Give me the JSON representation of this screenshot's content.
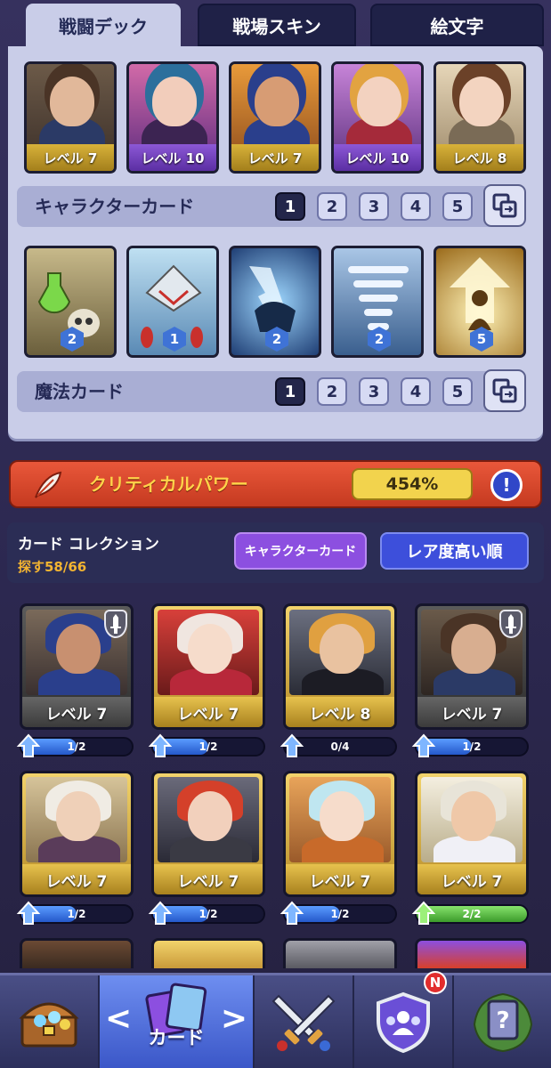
{
  "tabs": [
    {
      "label": "戦闘デック",
      "active": true
    },
    {
      "label": "戦場スキン",
      "active": false
    },
    {
      "label": "絵文字",
      "active": false
    }
  ],
  "deck": {
    "character_cards": [
      {
        "level": "レベル 7",
        "rarity": "gold"
      },
      {
        "level": "レベル 10",
        "rarity": "purple"
      },
      {
        "level": "レベル 7",
        "rarity": "gold"
      },
      {
        "level": "レベル 10",
        "rarity": "purple"
      },
      {
        "level": "レベル 8",
        "rarity": "gold"
      }
    ],
    "character_label": "キャラクターカード",
    "slot_numbers": [
      "1",
      "2",
      "3",
      "4",
      "5"
    ],
    "selected_slot": "1",
    "magic_cards": [
      {
        "badge": "2"
      },
      {
        "badge": "1"
      },
      {
        "badge": "2"
      },
      {
        "badge": "2"
      },
      {
        "badge": "5"
      }
    ],
    "magic_label": "魔法カード"
  },
  "critical": {
    "title": "クリティカルパワー",
    "value": "454%",
    "info_symbol": "!"
  },
  "collection": {
    "title": "カード コレクション",
    "found": "探す58/66",
    "filter_button": "キャラクターカード",
    "sort_button": "レア度高い順",
    "cards": [
      {
        "level": "レベル 7",
        "progress": "1/2",
        "ratio": 0.5,
        "frame": "dark",
        "sword": true
      },
      {
        "level": "レベル 7",
        "progress": "1/2",
        "ratio": 0.5,
        "frame": "gold",
        "sword": false
      },
      {
        "level": "レベル 8",
        "progress": "0/4",
        "ratio": 0.0,
        "frame": "gold",
        "sword": false
      },
      {
        "level": "レベル 7",
        "progress": "1/2",
        "ratio": 0.5,
        "frame": "dark",
        "sword": true
      },
      {
        "level": "レベル 7",
        "progress": "1/2",
        "ratio": 0.5,
        "frame": "gold",
        "sword": false
      },
      {
        "level": "レベル 7",
        "progress": "1/2",
        "ratio": 0.5,
        "frame": "gold",
        "sword": false
      },
      {
        "level": "レベル 7",
        "progress": "1/2",
        "ratio": 0.5,
        "frame": "gold",
        "sword": false
      },
      {
        "level": "レベル 7",
        "progress": "2/2",
        "ratio": 1.0,
        "frame": "gold",
        "sword": false
      }
    ]
  },
  "nav": {
    "items": [
      {
        "name": "shop",
        "icon": "treasure-chest-icon"
      },
      {
        "name": "cards",
        "label": "カード",
        "icon": "cards-icon",
        "active": true
      },
      {
        "name": "battle",
        "icon": "crossed-swords-icon"
      },
      {
        "name": "clan",
        "icon": "clan-shield-icon",
        "badge": "N"
      },
      {
        "name": "quest",
        "icon": "mystery-card-icon"
      }
    ],
    "prev_symbol": "<",
    "next_symbol": ">"
  },
  "colors": {
    "accent_red": "#d9482b",
    "gold": "#f2d34d",
    "purple_button": "#8c4fe0",
    "blue_button": "#3d4fdb",
    "progress_blue": "#2f6fe0",
    "progress_green": "#55c23e"
  }
}
